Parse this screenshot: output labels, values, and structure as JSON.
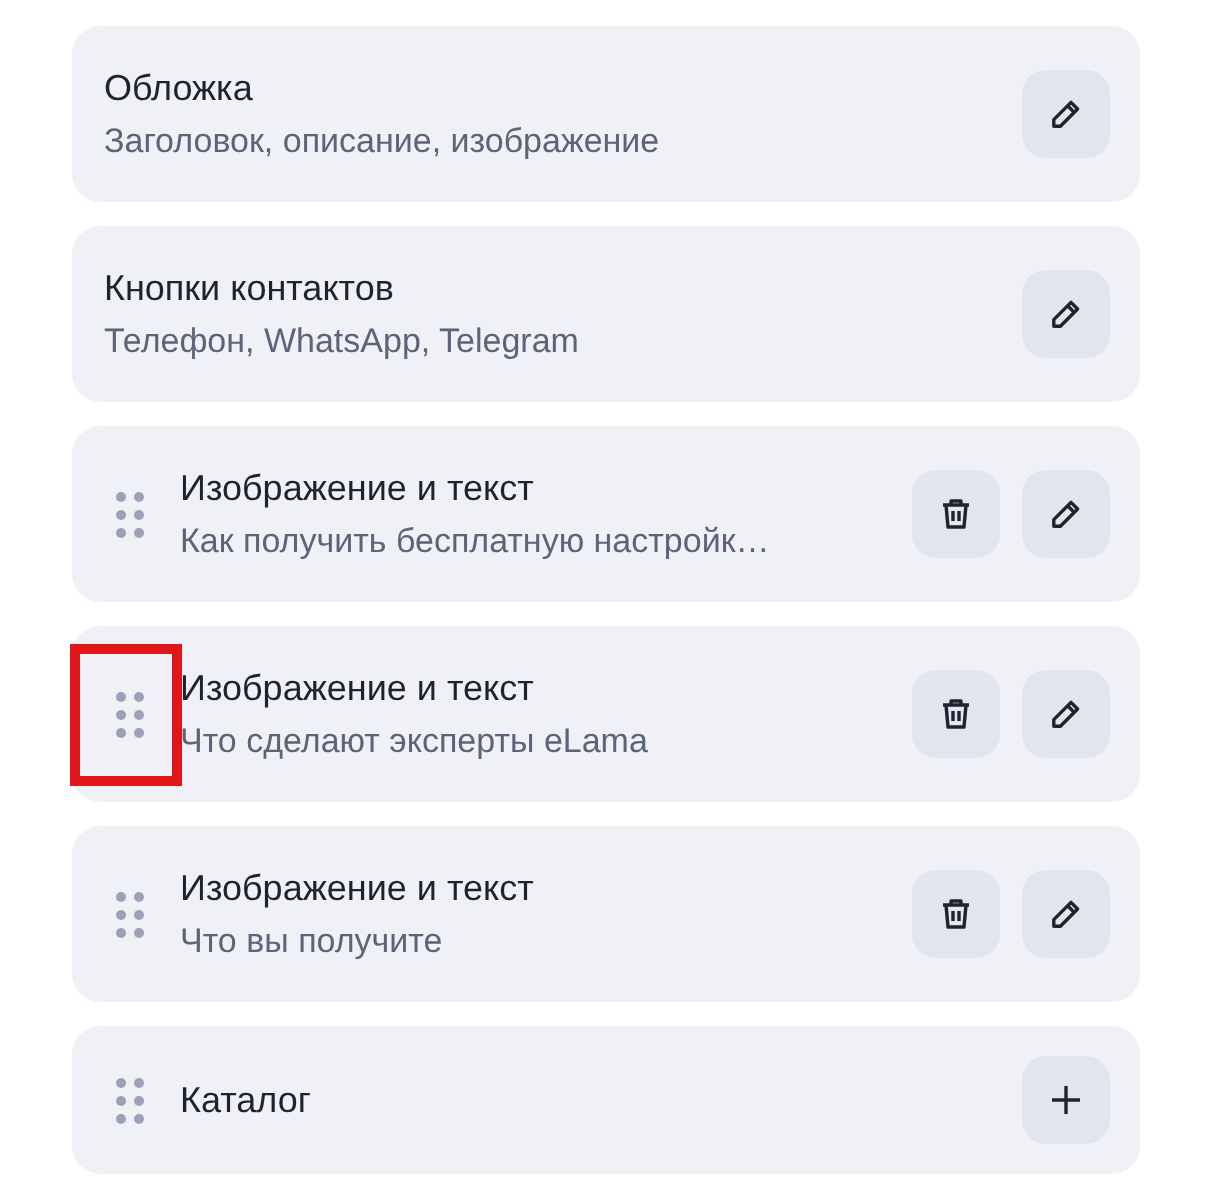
{
  "blocks": [
    {
      "title": "Обложка",
      "subtitle": "Заголовок, описание, изображение",
      "draggable": false,
      "deletable": false,
      "kind": "edit",
      "highlighted": false
    },
    {
      "title": "Кнопки контактов",
      "subtitle": "Телефон, WhatsApp, Telegram",
      "draggable": false,
      "deletable": false,
      "kind": "edit",
      "highlighted": false
    },
    {
      "title": "Изображение и текст",
      "subtitle": "Как получить бесплатную настройк…",
      "draggable": true,
      "deletable": true,
      "kind": "edit",
      "highlighted": false
    },
    {
      "title": "Изображение и текст",
      "subtitle": "Что сделают эксперты eLama",
      "draggable": true,
      "deletable": true,
      "kind": "edit",
      "highlighted": true
    },
    {
      "title": "Изображение и текст",
      "subtitle": "Что вы получите",
      "draggable": true,
      "deletable": true,
      "kind": "edit",
      "highlighted": false
    },
    {
      "title": "Каталог",
      "draggable": true,
      "deletable": false,
      "kind": "add",
      "highlighted": false
    }
  ]
}
